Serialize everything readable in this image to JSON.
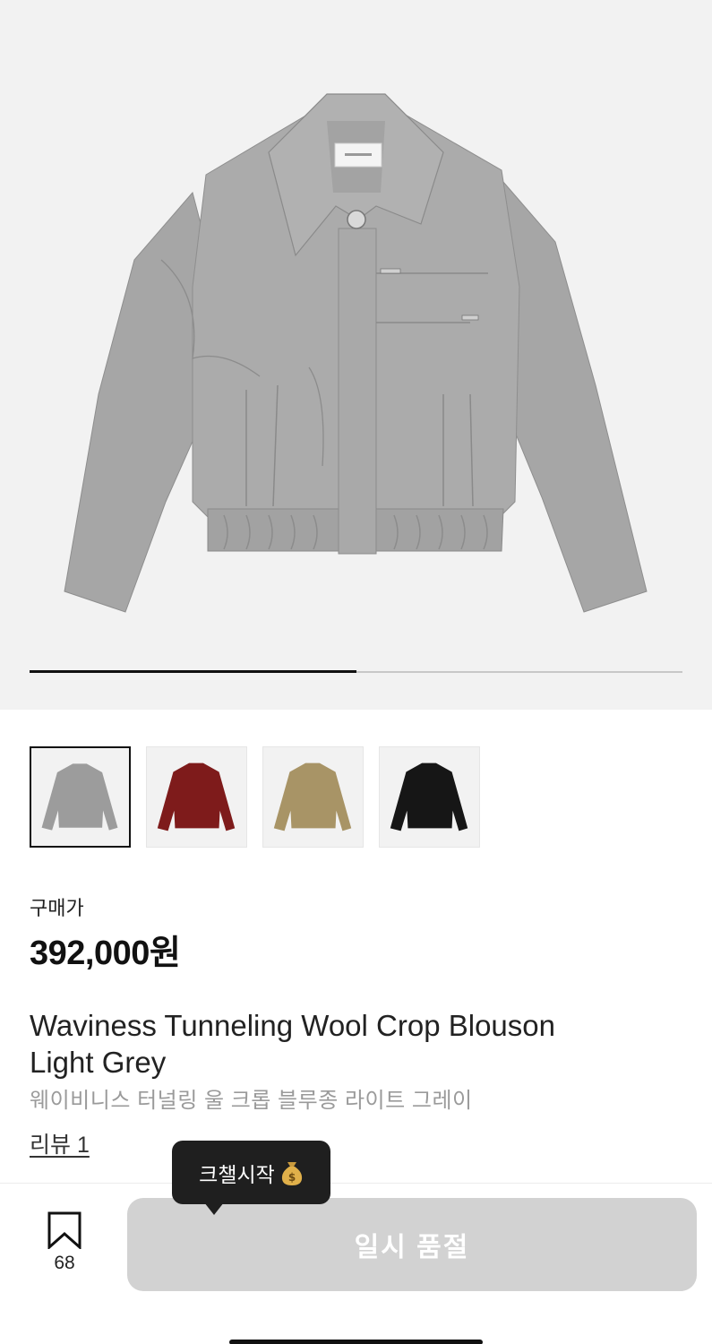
{
  "product": {
    "image_count": 2,
    "current_image": 1,
    "thumbnails": [
      {
        "name": "light-grey",
        "color": "#9c9c9c",
        "selected": true
      },
      {
        "name": "burgundy",
        "color": "#7e1b1b",
        "selected": false
      },
      {
        "name": "khaki",
        "color": "#a89466",
        "selected": false
      },
      {
        "name": "black",
        "color": "#161616",
        "selected": false
      }
    ],
    "price_label": "구매가",
    "price": "392,000원",
    "title_en_line1": "Waviness Tunneling Wool Crop Blouson",
    "title_en_line2": "Light Grey",
    "title_ko": "웨이비니스 터널링 울 크롭 블루종 라이트 그레이",
    "review_link": "리뷰 1"
  },
  "tooltip": {
    "text": "크챌시작",
    "icon": "money-bag-icon"
  },
  "bottom_bar": {
    "bookmark_count": "68",
    "button_label": "일시 품절"
  },
  "colors": {
    "hero_bg": "#f2f2f2",
    "button_disabled": "#d2d2d2",
    "tooltip_bg": "#1f1f1f"
  }
}
